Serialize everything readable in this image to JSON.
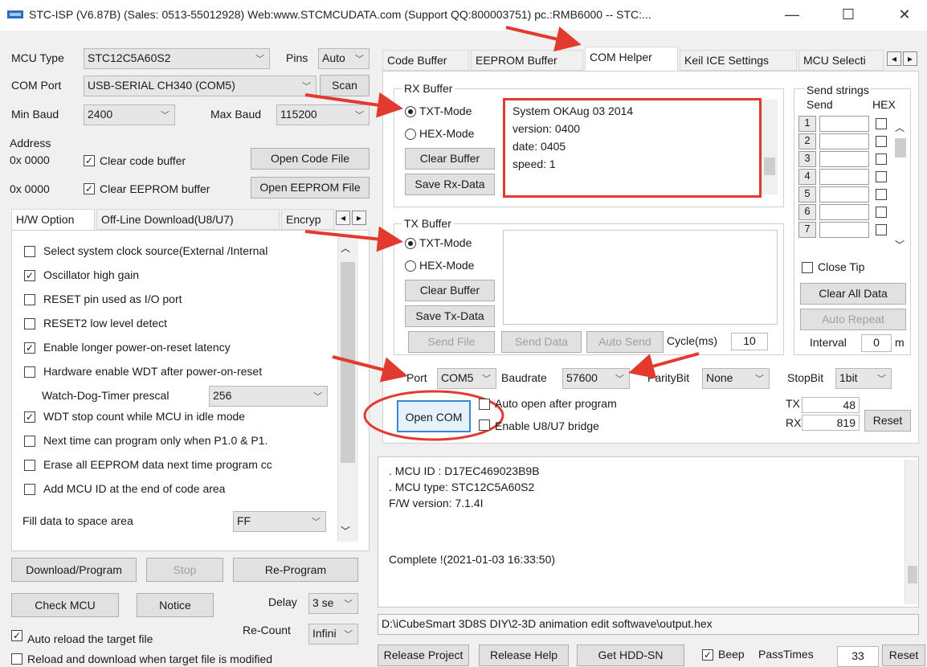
{
  "window": {
    "title": "STC-ISP (V6.87B) (Sales: 0513-55012928) Web:www.STCMCUDATA.com  (Support QQ:800003751) pc.:RMB6000 -- STC:...",
    "min": "—",
    "max": "☐",
    "close": "✕"
  },
  "left": {
    "mcu_type_label": "MCU Type",
    "mcu_type_value": "STC12C5A60S2",
    "pins_label": "Pins",
    "pins_value": "Auto",
    "com_port_label": "COM Port",
    "com_port_value": "USB-SERIAL CH340 (COM5)",
    "scan": "Scan",
    "min_baud_label": "Min Baud",
    "min_baud_value": "2400",
    "max_baud_label": "Max Baud",
    "max_baud_value": "115200",
    "address_label": "Address",
    "addr1": "0x 0000",
    "clear_code": "Clear code buffer",
    "open_code": "Open Code File",
    "addr2": "0x 0000",
    "clear_eeprom": "Clear EEPROM buffer",
    "open_eeprom": "Open EEPROM File",
    "tabs": [
      "H/W Option",
      "Off-Line Download(U8/U7)",
      "Encryp"
    ],
    "options": [
      {
        "label": "Select system clock source(External /Internal",
        "checked": false
      },
      {
        "label": "Oscillator high gain",
        "checked": true
      },
      {
        "label": "RESET pin used as I/O port",
        "checked": false
      },
      {
        "label": "RESET2 low level detect",
        "checked": false
      },
      {
        "label": "Enable longer power-on-reset latency",
        "checked": true
      },
      {
        "label": "Hardware enable WDT after power-on-reset",
        "checked": false
      }
    ],
    "wdt_label": "Watch-Dog-Timer prescal",
    "wdt_value": "256",
    "options2": [
      {
        "label": "WDT stop count while MCU in idle mode",
        "checked": true
      },
      {
        "label": "Next time can program only when P1.0 & P1.",
        "checked": false
      },
      {
        "label": "Erase all EEPROM data next time program cc",
        "checked": false
      },
      {
        "label": "Add MCU ID at the end of code area",
        "checked": false
      }
    ],
    "fill_label": "Fill data to space area",
    "fill_value": "FF",
    "download": "Download/Program",
    "stop": "Stop",
    "reprogram": "Re-Program",
    "check_mcu": "Check MCU",
    "notice": "Notice",
    "delay_label": "Delay",
    "delay_value": "3 se",
    "auto_reload": "Auto reload the target file",
    "recount_label": "Re-Count",
    "recount_value": "Infini",
    "reload_download": "Reload and download when target file is modified"
  },
  "right": {
    "tabs": [
      "Code Buffer",
      "EEPROM Buffer",
      "COM Helper",
      "Keil ICE Settings",
      "MCU Selecti"
    ],
    "rx_title": "RX Buffer",
    "tx_title": "TX Buffer",
    "txt_mode": "TXT-Mode",
    "hex_mode": "HEX-Mode",
    "clear_buffer": "Clear Buffer",
    "save_rx": "Save Rx-Data",
    "save_tx": "Save Tx-Data",
    "rx_lines": [
      "System OKAug 03 2014",
      "version: 0400",
      "date: 0405",
      "speed: 1"
    ],
    "send_file": "Send File",
    "send_data": "Send Data",
    "auto_send": "Auto Send",
    "cycle_label": "Cycle(ms)",
    "cycle_value": "10",
    "send_strings_title": "Send strings",
    "send_col": "Send",
    "hex_col": "HEX",
    "send_rows": [
      "1",
      "2",
      "3",
      "4",
      "5",
      "6",
      "7"
    ],
    "close_tip": "Close Tip",
    "clear_all": "Clear All Data",
    "auto_repeat": "Auto Repeat",
    "interval_label": "Interval",
    "interval_value": "0",
    "interval_unit": "m",
    "port_label": "Port",
    "port_value": "COM5",
    "baud_label": "Baudrate",
    "baud_value": "57600",
    "parity_label": "ParityBit",
    "parity_value": "None",
    "stopbit_label": "StopBit",
    "stopbit_value": "1bit",
    "open_com": "Open COM",
    "auto_open": "Auto open after program",
    "enable_bridge": "Enable U8/U7 bridge",
    "tx_label": "TX",
    "tx_count": "48",
    "rx_label": "RX",
    "rx_count": "819",
    "reset": "Reset",
    "log_lines": [
      ". MCU ID : D17EC469023B9B",
      ". MCU type: STC12C5A60S2",
      "F/W version: 7.1.4I"
    ],
    "complete": "Complete !(2021-01-03 16:33:50)",
    "path": "D:\\iCubeSmart 3D8S DIY\\2-3D animation edit softwave\\output.hex",
    "release_project": "Release Project",
    "release_help": "Release Help",
    "get_hdd": "Get HDD-SN",
    "beep": "Beep",
    "pass_label": "PassTimes",
    "pass_value": "33",
    "reset2": "Reset"
  },
  "colors": {
    "annotation": "#e23a2e"
  }
}
